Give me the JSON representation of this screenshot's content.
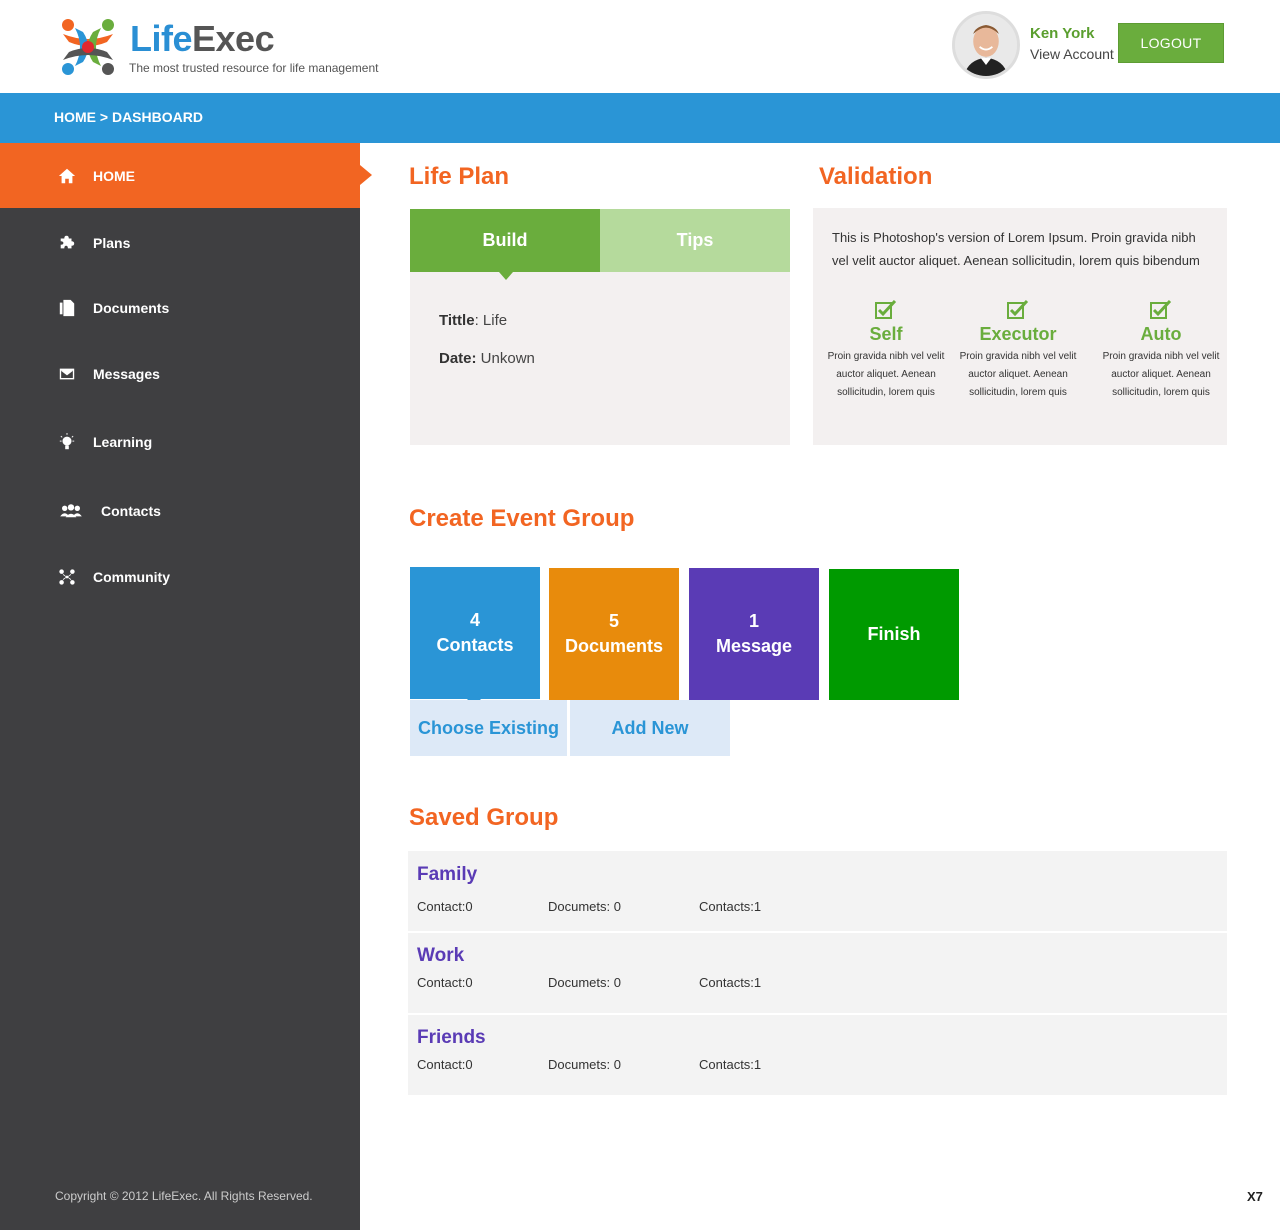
{
  "brand": {
    "name_part1": "Life",
    "name_part2": "Exec",
    "tagline": "The most trusted resource for life management"
  },
  "user": {
    "name": "Ken York",
    "view_account": "View Account",
    "logout_label": "LOGOUT"
  },
  "breadcrumb": "HOME > DASHBOARD",
  "sidebar": {
    "items": [
      {
        "label": "HOME",
        "icon": "home-icon"
      },
      {
        "label": "Plans",
        "icon": "puzzle-icon"
      },
      {
        "label": "Documents",
        "icon": "documents-icon"
      },
      {
        "label": "Messages",
        "icon": "envelope-icon"
      },
      {
        "label": "Learning",
        "icon": "lightbulb-icon"
      },
      {
        "label": "Contacts",
        "icon": "people-icon"
      },
      {
        "label": "Community",
        "icon": "community-icon"
      }
    ],
    "copyright": "Copyright © 2012 LifeExec. All Rights Reserved."
  },
  "life_plan": {
    "title": "Life Plan",
    "tab_build": "Build",
    "tab_tips": "Tips",
    "title_label": "Tittle",
    "title_value": ": Life",
    "date_label": "Date:",
    "date_value": " Unkown"
  },
  "validation": {
    "title": "Validation",
    "description": "This is Photoshop's version  of Lorem Ipsum. Proin gravida nibh vel velit auctor aliquet. Aenean sollicitudin, lorem quis bibendum",
    "columns": [
      {
        "title": "Self",
        "text": "Proin gravida nibh vel velit auctor aliquet. Aenean sollicitudin, lorem quis"
      },
      {
        "title": "Executor",
        "text": "Proin gravida nibh vel velit auctor aliquet. Aenean sollicitudin, lorem quis"
      },
      {
        "title": "Auto",
        "text": "Proin gravida nibh vel velit auctor aliquet. Aenean sollicitudin, lorem quis"
      }
    ]
  },
  "event_group": {
    "title": "Create Event Group",
    "tiles": [
      {
        "count": "4",
        "label": "Contacts"
      },
      {
        "count": "5",
        "label": "Documents"
      },
      {
        "count": "1",
        "label": "Message"
      },
      {
        "count": "",
        "label": "Finish"
      }
    ],
    "choose_existing": "Choose Existing",
    "add_new": "Add New"
  },
  "saved_group": {
    "title": "Saved Group",
    "rows": [
      {
        "name": "Family",
        "contact": "Contact:0",
        "documents": "Documets: 0",
        "contacts": "Contacts:1"
      },
      {
        "name": "Work",
        "contact": "Contact:0",
        "documents": "Documets: 0",
        "contacts": "Contacts:1"
      },
      {
        "name": "Friends",
        "contact": "Contact:0",
        "documents": "Documets: 0",
        "contacts": "Contacts:1"
      }
    ]
  },
  "version": "X7",
  "colors": {
    "accent_orange": "#f26522",
    "accent_blue": "#2a95d6",
    "accent_green": "#6aad3d",
    "sidebar_bg": "#3f3f41",
    "purple": "#5a3bb5"
  }
}
